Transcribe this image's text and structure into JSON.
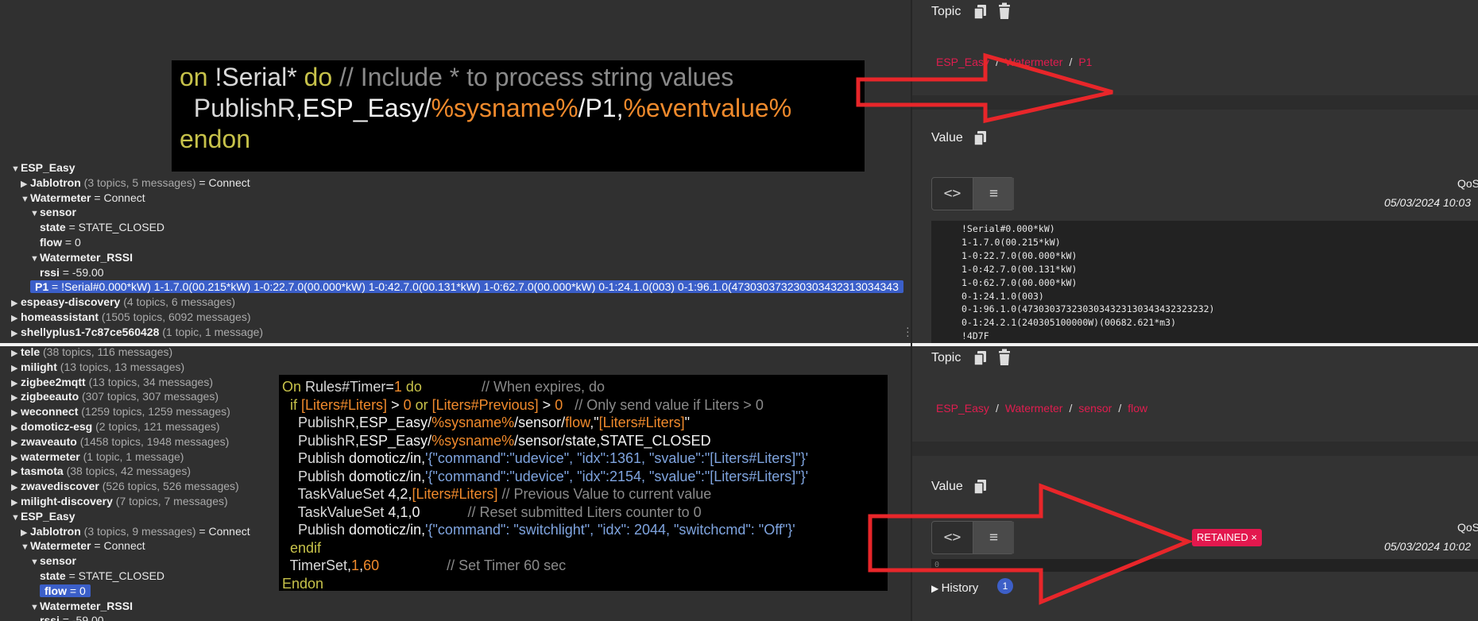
{
  "tree_top": {
    "rows": [
      {
        "indent": 0,
        "tri": "▼",
        "key": "ESP_Easy",
        "count": "",
        "value": ""
      },
      {
        "indent": 1,
        "tri": "▶",
        "key": "Jablotron",
        "count": "(3 topics, 5 messages)",
        "value": "= Connect"
      },
      {
        "indent": 1,
        "tri": "▼",
        "key": "Watermeter",
        "count": "",
        "value": "= Connect"
      },
      {
        "indent": 2,
        "tri": "▼",
        "key": "sensor",
        "count": "",
        "value": ""
      },
      {
        "indent": 3,
        "tri": "",
        "key": "state",
        "count": "",
        "value": "= STATE_CLOSED"
      },
      {
        "indent": 3,
        "tri": "",
        "key": "flow",
        "count": "",
        "value": "= 0"
      },
      {
        "indent": 2,
        "tri": "▼",
        "key": "Watermeter_RSSI",
        "count": "",
        "value": ""
      },
      {
        "indent": 3,
        "tri": "",
        "key": "rssi",
        "count": "",
        "value": "= -59.00"
      },
      {
        "indent": 2,
        "tri": "",
        "key": "P1",
        "count": "",
        "value": "= !Serial#0.000*kW) 1-1.7.0(00.215*kW) 1-0:22.7.0(00.000*kW) 1-0:42.7.0(00.131*kW) 1-0:62.7.0(00.000*kW) 0-1:24.1.0(003) 0-1:96.1.0(473030373230303432313034343",
        "selected": true
      },
      {
        "indent": 0,
        "tri": "▶",
        "key": "espeasy-discovery",
        "count": "(4 topics, 6 messages)",
        "value": ""
      },
      {
        "indent": 0,
        "tri": "▶",
        "key": "homeassistant",
        "count": "(1505 topics, 6092 messages)",
        "value": ""
      },
      {
        "indent": 0,
        "tri": "▶",
        "key": "shellyplus1-7c87ce560428",
        "count": "(1 topic, 1 message)",
        "value": ""
      }
    ]
  },
  "tree_bottom": {
    "rows": [
      {
        "indent": 0,
        "tri": "▶",
        "key": "tele",
        "count": "(38 topics, 116 messages)",
        "value": ""
      },
      {
        "indent": 0,
        "tri": "▶",
        "key": "milight",
        "count": "(13 topics, 13 messages)",
        "value": ""
      },
      {
        "indent": 0,
        "tri": "▶",
        "key": "zigbee2mqtt",
        "count": "(13 topics, 34 messages)",
        "value": ""
      },
      {
        "indent": 0,
        "tri": "▶",
        "key": "zigbeeauto",
        "count": "(307 topics, 307 messages)",
        "value": ""
      },
      {
        "indent": 0,
        "tri": "▶",
        "key": "weconnect",
        "count": "(1259 topics, 1259 messages)",
        "value": ""
      },
      {
        "indent": 0,
        "tri": "▶",
        "key": "domoticz-esg",
        "count": "(2 topics, 121 messages)",
        "value": ""
      },
      {
        "indent": 0,
        "tri": "▶",
        "key": "zwaveauto",
        "count": "(1458 topics, 1948 messages)",
        "value": ""
      },
      {
        "indent": 0,
        "tri": "▶",
        "key": "watermeter",
        "count": "(1 topic, 1 message)",
        "value": ""
      },
      {
        "indent": 0,
        "tri": "▶",
        "key": "tasmota",
        "count": "(38 topics, 42 messages)",
        "value": ""
      },
      {
        "indent": 0,
        "tri": "▶",
        "key": "zwavediscover",
        "count": "(526 topics, 526 messages)",
        "value": ""
      },
      {
        "indent": 0,
        "tri": "▶",
        "key": "milight-discovery",
        "count": "(7 topics, 7 messages)",
        "value": ""
      },
      {
        "indent": 0,
        "tri": "▼",
        "key": "ESP_Easy",
        "count": "",
        "value": ""
      },
      {
        "indent": 1,
        "tri": "▶",
        "key": "Jablotron",
        "count": "(3 topics, 9 messages)",
        "value": "= Connect"
      },
      {
        "indent": 1,
        "tri": "▼",
        "key": "Watermeter",
        "count": "",
        "value": "= Connect"
      },
      {
        "indent": 2,
        "tri": "▼",
        "key": "sensor",
        "count": "",
        "value": ""
      },
      {
        "indent": 3,
        "tri": "",
        "key": "state",
        "count": "",
        "value": "= STATE_CLOSED"
      },
      {
        "indent": 3,
        "tri": "",
        "key": "flow",
        "count": "",
        "value": "= 0",
        "selected": true
      },
      {
        "indent": 2,
        "tri": "▼",
        "key": "Watermeter_RSSI",
        "count": "",
        "value": ""
      },
      {
        "indent": 3,
        "tri": "",
        "key": "rssi",
        "count": "",
        "value": "= -59.00"
      }
    ]
  },
  "code_top": {
    "lines": [
      [
        {
          "c": "kw",
          "t": "on "
        },
        {
          "c": "id",
          "t": "!Serial* "
        },
        {
          "c": "kw",
          "t": "do "
        },
        {
          "c": "cm",
          "t": "// Include * to process string values"
        }
      ],
      [
        {
          "c": "id",
          "t": "  PublishR"
        },
        {
          "c": "nm",
          "t": ",ESP_Easy/"
        },
        {
          "c": "vr",
          "t": "%sysname%"
        },
        {
          "c": "nm",
          "t": "/P1,"
        },
        {
          "c": "vr",
          "t": "%eventvalue%"
        }
      ],
      [
        {
          "c": "kw",
          "t": "endon"
        }
      ]
    ]
  },
  "code_bottom": {
    "lines": [
      [
        {
          "c": "kw",
          "t": "On "
        },
        {
          "c": "id",
          "t": "Rules#Timer"
        },
        {
          "c": "nm",
          "t": "="
        },
        {
          "c": "vr",
          "t": "1"
        },
        {
          "c": "kw",
          "t": " do"
        },
        {
          "c": "cm",
          "t": "               // When expires, do"
        }
      ],
      [
        {
          "c": "kw",
          "t": "  if "
        },
        {
          "c": "vr",
          "t": "[Liters#Liters]"
        },
        {
          "c": "nm",
          "t": " > "
        },
        {
          "c": "vr",
          "t": "0"
        },
        {
          "c": "kw",
          "t": " or "
        },
        {
          "c": "vr",
          "t": "[Liters#Previous]"
        },
        {
          "c": "nm",
          "t": " > "
        },
        {
          "c": "vr",
          "t": "0"
        },
        {
          "c": "cm",
          "t": "   // Only send value if Liters > 0"
        }
      ],
      [
        {
          "c": "id",
          "t": "    PublishR"
        },
        {
          "c": "nm",
          "t": ",ESP_Easy/"
        },
        {
          "c": "vr",
          "t": "%sysname%"
        },
        {
          "c": "nm",
          "t": "/sensor/"
        },
        {
          "c": "vr",
          "t": "flow"
        },
        {
          "c": "nm",
          "t": ",\""
        },
        {
          "c": "vr",
          "t": "[Liters#Liters]"
        },
        {
          "c": "nm",
          "t": "\""
        }
      ],
      [
        {
          "c": "id",
          "t": "    PublishR"
        },
        {
          "c": "nm",
          "t": ",ESP_Easy/"
        },
        {
          "c": "vr",
          "t": "%sysname%"
        },
        {
          "c": "nm",
          "t": "/sensor/state,STATE_CLOSED"
        }
      ],
      [
        {
          "c": "id",
          "t": "    Publish "
        },
        {
          "c": "nm",
          "t": "domoticz/in,"
        },
        {
          "c": "str",
          "t": "'{\"command\":\"udevice\", \"idx\":1361, \"svalue\":\"[Liters#Liters]\"}'"
        }
      ],
      [
        {
          "c": "id",
          "t": "    Publish "
        },
        {
          "c": "nm",
          "t": "domoticz/in,"
        },
        {
          "c": "str",
          "t": "'{\"command\":\"udevice\", \"idx\":2154, \"svalue\":\"[Liters#Liters]\"}'"
        }
      ],
      [
        {
          "c": "id",
          "t": "    TaskValueSet "
        },
        {
          "c": "nm",
          "t": "4,2,"
        },
        {
          "c": "vr",
          "t": "[Liters#Liters]"
        },
        {
          "c": "cm",
          "t": " // Previous Value to current value"
        }
      ],
      [
        {
          "c": "id",
          "t": "    TaskValueSet "
        },
        {
          "c": "nm",
          "t": "4,1,0"
        },
        {
          "c": "cm",
          "t": "            // Reset submitted Liters counter to 0"
        }
      ],
      [
        {
          "c": "id",
          "t": "    Publish "
        },
        {
          "c": "nm",
          "t": "domoticz/in,"
        },
        {
          "c": "str",
          "t": "'{\"command\": \"switchlight\", \"idx\": 2044, \"switchcmd\": \"Off\"}'"
        }
      ],
      [
        {
          "c": "kw",
          "t": "  endif"
        }
      ],
      [
        {
          "c": "id",
          "t": "  TimerSet"
        },
        {
          "c": "nm",
          "t": ","
        },
        {
          "c": "vr",
          "t": "1"
        },
        {
          "c": "nm",
          "t": ","
        },
        {
          "c": "vr",
          "t": "60"
        },
        {
          "c": "cm",
          "t": "                 // Set Timer 60 sec"
        }
      ],
      [
        {
          "c": "kw",
          "t": "Endon"
        }
      ]
    ]
  },
  "right_top": {
    "topic_label": "Topic",
    "breadcrumb": [
      "ESP_Easy",
      "Watermeter",
      "P1"
    ],
    "value_label": "Value",
    "qos": "QoS",
    "timestamp": "05/03/2024 10:03",
    "payload": "!Serial#0.000*kW)\n1-1.7.0(00.215*kW)\n1-0:22.7.0(00.000*kW)\n1-0:42.7.0(00.131*kW)\n1-0:62.7.0(00.000*kW)\n0-1:24.1.0(003)\n0-1:96.1.0(4730303732303034323130343432323232)\n0-1:24.2.1(240305100000W)(00682.621*m3)\n!4D7F"
  },
  "right_bottom": {
    "topic_label": "Topic",
    "breadcrumb": [
      "ESP_Easy",
      "Watermeter",
      "sensor",
      "flow"
    ],
    "value_label": "Value",
    "qos": "QoS",
    "timestamp": "05/03/2024 10:02",
    "retained": "RETAINED ×",
    "payload": "0",
    "history": "History",
    "history_count": "1"
  },
  "colors": {
    "accent": "#e01d4f",
    "selection": "#3b5fc9",
    "arrow": "#e8262a"
  }
}
